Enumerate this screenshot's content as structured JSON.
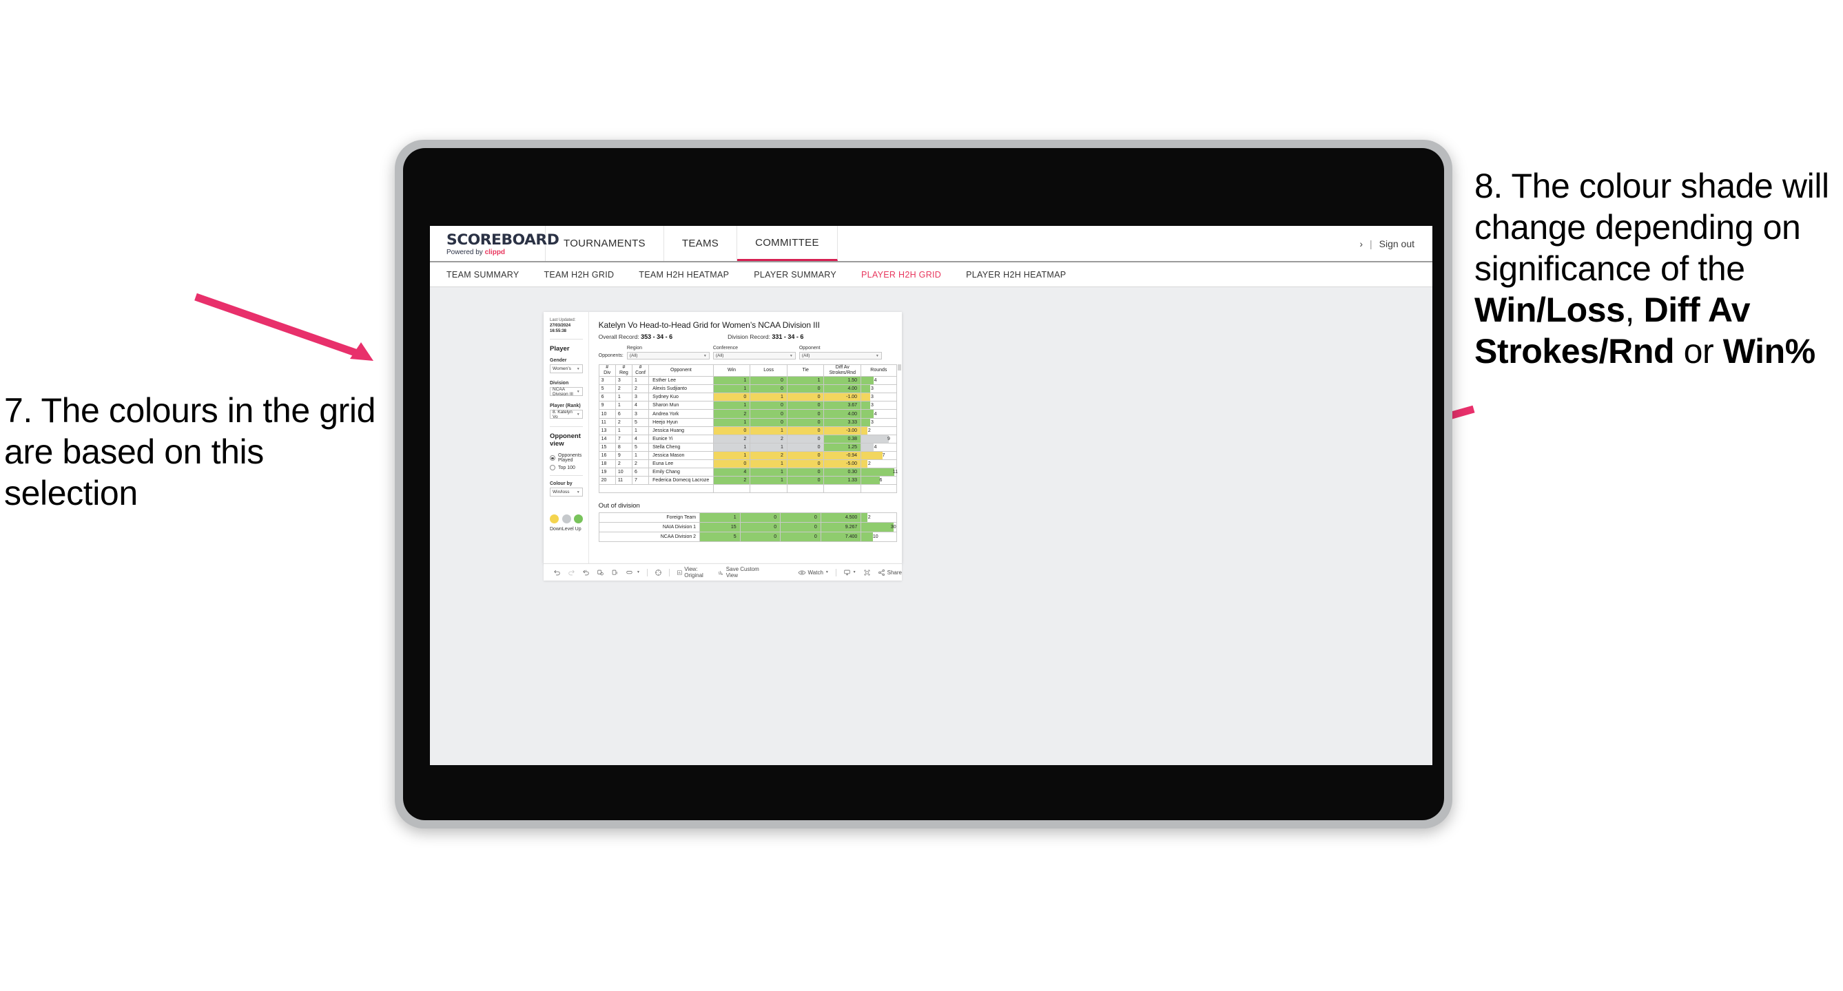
{
  "annotations": {
    "left": {
      "text": "7. The colours in the grid are based on this selection",
      "arrow_color": "#e8306b"
    },
    "right": {
      "prefix": "8. The colour shade will change depending on significance of the ",
      "bold1": "Win/Loss",
      "mid1": ", ",
      "bold2": "Diff Av Strokes/Rnd",
      "mid2": " or ",
      "bold3": "Win%",
      "arrow_color": "#e8306b"
    }
  },
  "app": {
    "brand": {
      "logo": "SCOREBOARD",
      "powered_prefix": "Powered by ",
      "powered_brand": "clippd"
    },
    "topnav": [
      {
        "label": "TOURNAMENTS",
        "active": false
      },
      {
        "label": "TEAMS",
        "active": false
      },
      {
        "label": "COMMITTEE",
        "active": true
      }
    ],
    "topbar_right": {
      "chevron": "›",
      "sep": "|",
      "signout": "Sign out"
    },
    "subnav": [
      {
        "label": "TEAM SUMMARY",
        "active": false
      },
      {
        "label": "TEAM H2H GRID",
        "active": false
      },
      {
        "label": "TEAM H2H HEATMAP",
        "active": false
      },
      {
        "label": "PLAYER SUMMARY",
        "active": false
      },
      {
        "label": "PLAYER H2H GRID",
        "active": true
      },
      {
        "label": "PLAYER H2H HEATMAP",
        "active": false
      }
    ]
  },
  "sidebar": {
    "last_updated_label": "Last Updated: ",
    "last_updated_value": "27/03/2024 16:55:38",
    "section_player": "Player",
    "gender": {
      "label": "Gender",
      "value": "Women’s"
    },
    "division": {
      "label": "Division",
      "value": "NCAA Division III"
    },
    "player_rank": {
      "label": "Player (Rank)",
      "value": "8. Katelyn Vo"
    },
    "opponent_view": {
      "title": "Opponent view",
      "options": [
        {
          "label": "Opponents Played",
          "selected": true
        },
        {
          "label": "Top 100",
          "selected": false
        }
      ]
    },
    "colour_by": {
      "label": "Colour by",
      "value": "Win/loss"
    },
    "legend": [
      {
        "caption": "Down",
        "color": "#f4d44f"
      },
      {
        "caption": "Level",
        "color": "#c6c9cc"
      },
      {
        "caption": "Up",
        "color": "#78c35b"
      }
    ]
  },
  "main": {
    "title": "Katelyn Vo Head-to-Head Grid for Women’s NCAA Division III",
    "overall_record_label": "Overall Record: ",
    "overall_record_value": "353 -  34 - 6",
    "division_record_label": "Division Record: ",
    "division_record_value": "331 -  34 - 6",
    "opponents_label": "Opponents:",
    "filters": [
      {
        "label": "Region",
        "value": "(All)"
      },
      {
        "label": "Conference",
        "value": "(All)"
      },
      {
        "label": "Opponent",
        "value": "(All)"
      }
    ],
    "columns": [
      {
        "line1": "#",
        "line2": "Div"
      },
      {
        "line1": "#",
        "line2": "Reg"
      },
      {
        "line1": "#",
        "line2": "Conf"
      },
      {
        "line1": "Opponent",
        "line2": ""
      },
      {
        "line1": "Win",
        "line2": ""
      },
      {
        "line1": "Loss",
        "line2": ""
      },
      {
        "line1": "Tie",
        "line2": ""
      },
      {
        "line1": "Diff Av",
        "line2": "Strokes/Rnd"
      },
      {
        "line1": "Rounds",
        "line2": ""
      }
    ],
    "rows": [
      {
        "div": "3",
        "reg": "3",
        "conf": "1",
        "opponent": "Esther Lee",
        "win": "1",
        "loss": "0",
        "tie": "1",
        "diff": "1.50",
        "rounds": "4",
        "fill": "#8fcc6e",
        "bar_pct": 36
      },
      {
        "div": "5",
        "reg": "2",
        "conf": "2",
        "opponent": "Alexis Sudjianto",
        "win": "1",
        "loss": "0",
        "tie": "0",
        "diff": "4.00",
        "rounds": "3",
        "fill": "#8fcc6e",
        "bar_pct": 26
      },
      {
        "div": "6",
        "reg": "1",
        "conf": "3",
        "opponent": "Sydney Kuo",
        "win": "0",
        "loss": "1",
        "tie": "0",
        "diff": "-1.00",
        "rounds": "3",
        "fill": "#f2d65e",
        "bar_pct": 26
      },
      {
        "div": "9",
        "reg": "1",
        "conf": "4",
        "opponent": "Sharon Mun",
        "win": "1",
        "loss": "0",
        "tie": "0",
        "diff": "3.67",
        "rounds": "3",
        "fill": "#8fcc6e",
        "bar_pct": 26
      },
      {
        "div": "10",
        "reg": "6",
        "conf": "3",
        "opponent": "Andrea York",
        "win": "2",
        "loss": "0",
        "tie": "0",
        "diff": "4.00",
        "rounds": "4",
        "fill": "#8fcc6e",
        "bar_pct": 36
      },
      {
        "div": "11",
        "reg": "2",
        "conf": "5",
        "opponent": "Heejo Hyun",
        "win": "1",
        "loss": "0",
        "tie": "0",
        "diff": "3.33",
        "rounds": "3",
        "fill": "#8fcc6e",
        "bar_pct": 26
      },
      {
        "div": "13",
        "reg": "1",
        "conf": "1",
        "opponent": "Jessica Huang",
        "win": "0",
        "loss": "1",
        "tie": "0",
        "diff": "-3.00",
        "rounds": "2",
        "fill": "#f2d65e",
        "bar_pct": 17
      },
      {
        "div": "14",
        "reg": "7",
        "conf": "4",
        "opponent": "Eunice Yi",
        "win": "2",
        "loss": "2",
        "tie": "0",
        "diff": "0.38",
        "rounds": "9",
        "fill": "#d3d5d7",
        "bar_pct": 78,
        "diff_fill": "#8fcc6e"
      },
      {
        "div": "15",
        "reg": "8",
        "conf": "5",
        "opponent": "Stella Cheng",
        "win": "1",
        "loss": "1",
        "tie": "0",
        "diff": "1.25",
        "rounds": "4",
        "fill": "#d3d5d7",
        "bar_pct": 36,
        "diff_fill": "#8fcc6e"
      },
      {
        "div": "16",
        "reg": "9",
        "conf": "1",
        "opponent": "Jessica Mason",
        "win": "1",
        "loss": "2",
        "tie": "0",
        "diff": "-0.94",
        "rounds": "7",
        "fill": "#f2d65e",
        "bar_pct": 62
      },
      {
        "div": "18",
        "reg": "2",
        "conf": "2",
        "opponent": "Euna Lee",
        "win": "0",
        "loss": "1",
        "tie": "0",
        "diff": "-5.00",
        "rounds": "2",
        "fill": "#f2d65e",
        "bar_pct": 17
      },
      {
        "div": "19",
        "reg": "10",
        "conf": "6",
        "opponent": "Emily Chang",
        "win": "4",
        "loss": "1",
        "tie": "0",
        "diff": "0.30",
        "rounds": "11",
        "fill": "#8fcc6e",
        "bar_pct": 95
      },
      {
        "div": "20",
        "reg": "11",
        "conf": "7",
        "opponent": "Federica Domecq Lacroze",
        "win": "2",
        "loss": "1",
        "tie": "0",
        "diff": "1.33",
        "rounds": "6",
        "fill": "#8fcc6e",
        "bar_pct": 53
      }
    ],
    "out_of_division": {
      "title": "Out of division",
      "rows": [
        {
          "name": "Foreign Team",
          "win": "1",
          "loss": "0",
          "tie": "0",
          "diff": "4.500",
          "rounds": "2",
          "fill": "#8fcc6e",
          "bar_pct": 17
        },
        {
          "name": "NAIA Division 1",
          "win": "15",
          "loss": "0",
          "tie": "0",
          "diff": "9.267",
          "rounds": "30",
          "fill": "#8fcc6e",
          "bar_pct": 92
        },
        {
          "name": "NCAA Division 2",
          "win": "5",
          "loss": "0",
          "tie": "0",
          "diff": "7.400",
          "rounds": "10",
          "fill": "#8fcc6e",
          "bar_pct": 33
        }
      ]
    }
  },
  "toolbar": {
    "view_label": "View: Original",
    "save_label": "Save Custom View",
    "watch_label": "Watch",
    "share_label": "Share"
  }
}
